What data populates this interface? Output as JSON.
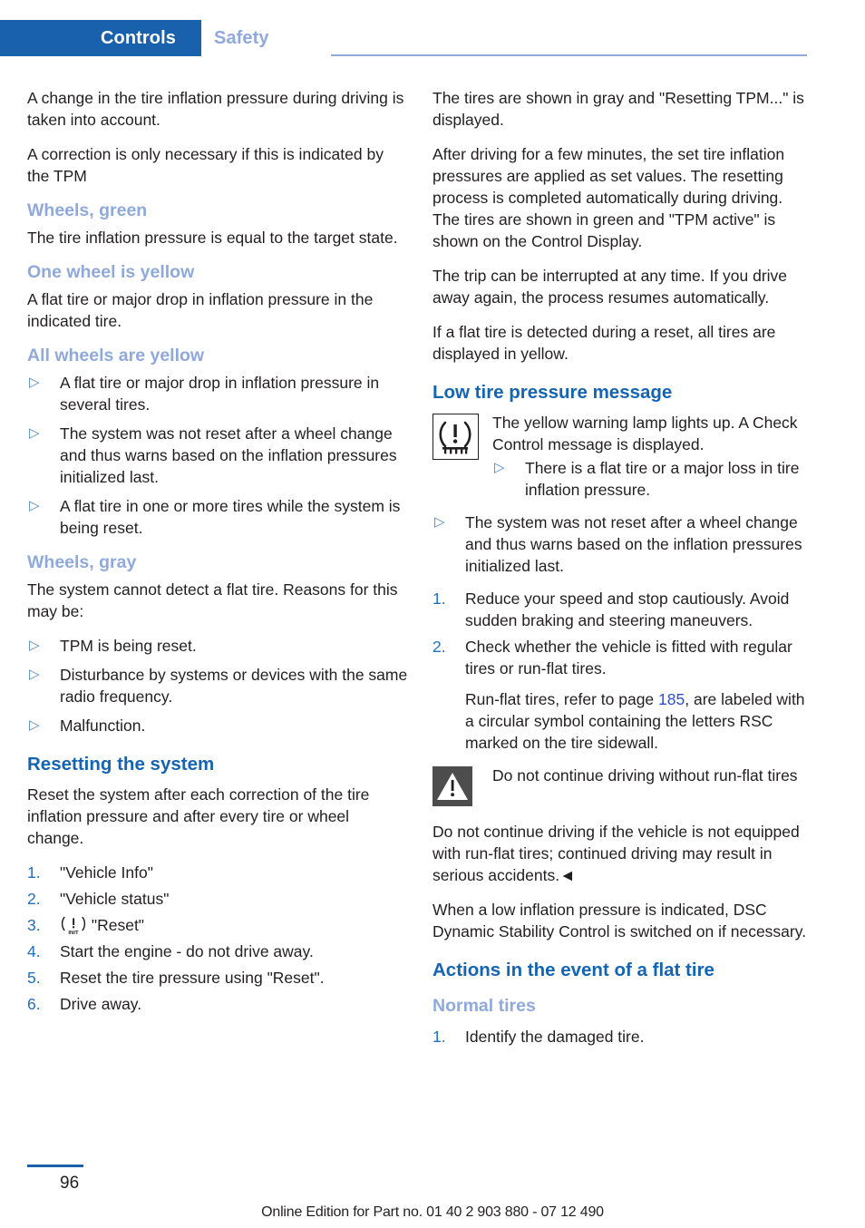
{
  "header": {
    "tab_active": "Controls",
    "tab_inactive": "Safety",
    "accent_blue": "#1961ac",
    "light_blue": "#8fa9dd"
  },
  "left_column": {
    "p1": "A change in the tire inflation pressure during driving is taken into account.",
    "p2": "A correction is only necessary if this is indicated by the TPM",
    "h_wheels_green": "Wheels, green",
    "p3": "The tire inflation pressure is equal to the target state.",
    "h_one_wheel_yellow": "One wheel is yellow",
    "p4": "A flat tire or major drop in inflation pressure in the indicated tire.",
    "h_all_wheels_yellow": "All wheels are yellow",
    "bullets_all_yellow": [
      "A flat tire or major drop in inflation pressure in several tires.",
      "The system was not reset after a wheel change and thus warns based on the inflation pressures initialized last.",
      "A flat tire in one or more tires while the system is being reset."
    ],
    "h_wheels_gray": "Wheels, gray",
    "p5": "The system cannot detect a flat tire. Reasons for this may be:",
    "bullets_gray": [
      "TPM is being reset.",
      "Disturbance by systems or devices with the same radio frequency.",
      "Malfunction."
    ],
    "h_resetting": "Resetting the system",
    "p6": "Reset the system after each correction of the tire inflation pressure and after every tire or wheel change.",
    "steps": [
      {
        "num": "1.",
        "text": "\"Vehicle Info\""
      },
      {
        "num": "2.",
        "text": "\"Vehicle status\""
      },
      {
        "num": "3.",
        "text": "\"Reset\"",
        "icon": "tpm-init-icon"
      },
      {
        "num": "4.",
        "text": "Start the engine - do not drive away."
      },
      {
        "num": "5.",
        "text": "Reset the tire pressure using \"Reset\"."
      },
      {
        "num": "6.",
        "text": "Drive away."
      }
    ]
  },
  "right_column": {
    "p1": "The tires are shown in gray and \"Resetting TPM...\" is displayed.",
    "p2": "After driving for a few minutes, the set tire inflation pressures are applied as set values. The resetting process is completed automatically during driving. The tires are shown in green and \"TPM active\" is shown on the Control Display.",
    "p3": "The trip can be interrupted at any time. If you drive away again, the process resumes automatically.",
    "p4": "If a flat tire is detected during a reset, all tires are displayed in yellow.",
    "h_low_tire_pressure": "Low tire pressure message",
    "note_tpm": {
      "icon": "tpm-warning-lamp-icon",
      "text": "The yellow warning lamp lights up. A Check Control message is displayed.",
      "bullets": [
        "There is a flat tire or a major loss in tire inflation pressure."
      ]
    },
    "bullets_after_note": [
      "The system was not reset after a wheel change and thus warns based on the inflation pressures initialized last."
    ],
    "steps": [
      {
        "num": "1.",
        "text": "Reduce your speed and stop cautiously. Avoid sudden braking and steering maneuvers."
      },
      {
        "num": "2.",
        "text": "Check whether the vehicle is fitted with regular tires or run-flat tires.",
        "cont_pre": "Run-flat tires, refer to page ",
        "cont_link": "185",
        "cont_post": ", are labeled with a circular symbol containing the letters RSC marked on the tire sidewall."
      }
    ],
    "warning": {
      "icon": "warning-triangle-icon",
      "title": "Do not continue driving without run-flat tires",
      "body": "Do not continue driving if the vehicle is not equipped with run-flat tires; continued driving may result in serious accidents.",
      "end_marker": "◄"
    },
    "p5": "When a low inflation pressure is indicated, DSC Dynamic Stability Control is switched on if necessary.",
    "h_actions": "Actions in the event of a flat tire",
    "h_normal_tires": "Normal tires",
    "steps2": [
      {
        "num": "1.",
        "text": "Identify the damaged tire."
      }
    ]
  },
  "footer": {
    "page_number": "96",
    "edition_text": "Online Edition for Part no. 01 40 2 903 880 - 07 12 490"
  }
}
